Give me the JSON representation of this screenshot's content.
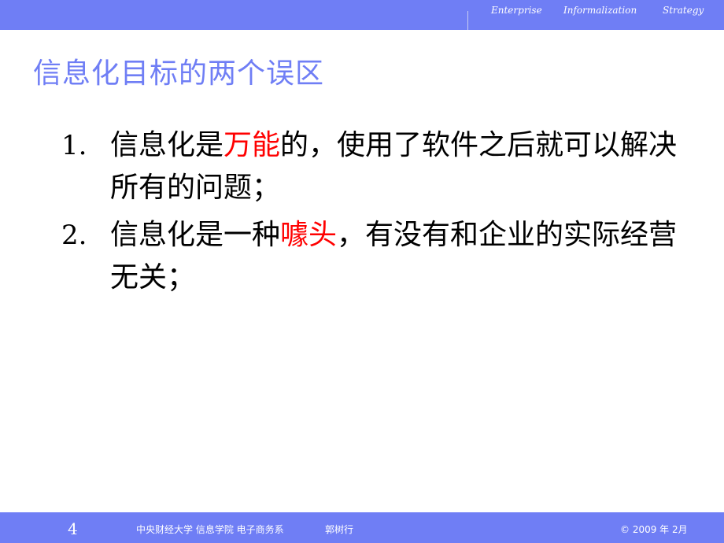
{
  "header": {
    "tagline": [
      "Enterprise",
      "Informalization",
      "Strategy"
    ]
  },
  "title": "信息化目标的两个误区",
  "items": [
    {
      "number": "1.",
      "before": "信息化是",
      "highlight": "万能",
      "after": "的，使用了软件之后就可以解决所有的问题；"
    },
    {
      "number": "2.",
      "before": "信息化是一种",
      "highlight": "噱头",
      "after": "，有没有和企业的实际经营无关；"
    }
  ],
  "colors": {
    "accent": "#6f7ef5",
    "highlight": "#ff0000",
    "text": "#000000"
  },
  "footer": {
    "page_number": "4",
    "organization": "中央财经大学 信息学院 电子商务系",
    "author": "郭树行",
    "date": "© 2009 年 2月"
  }
}
